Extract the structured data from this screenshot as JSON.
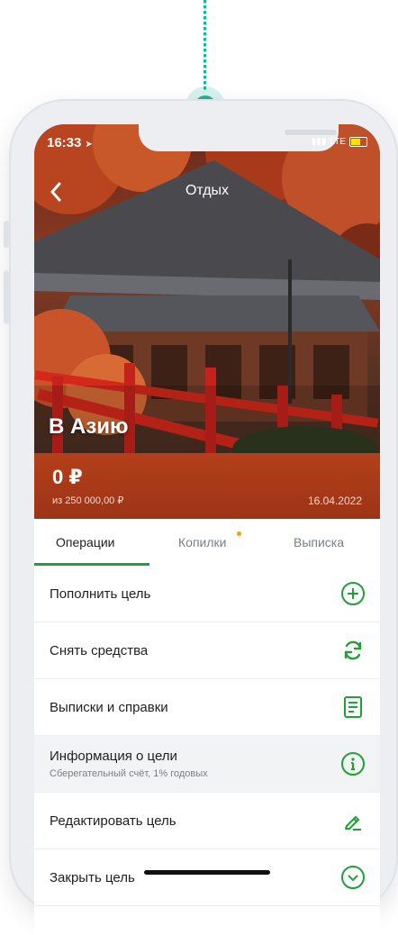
{
  "status_bar": {
    "time": "16:33",
    "network": "LTE"
  },
  "header": {
    "title": "Отдых",
    "goal_name": "В Азию"
  },
  "goal": {
    "amount": "0 ₽",
    "target": "из 250 000,00 ₽",
    "date": "16.04.2022"
  },
  "tabs": [
    {
      "label": "Операции",
      "active": true
    },
    {
      "label": "Копилки",
      "has_badge": true
    },
    {
      "label": "Выписка"
    }
  ],
  "actions": [
    {
      "label": "Пополнить цель",
      "icon": "plus-circle-icon"
    },
    {
      "label": "Снять средства",
      "icon": "refresh-icon"
    },
    {
      "label": "Выписки и справки",
      "icon": "document-icon"
    },
    {
      "label": "Информация о цели",
      "sub": "Сберегательный счёт,  1% годовых",
      "icon": "info-icon"
    },
    {
      "label": "Редактировать цель",
      "icon": "pencil-icon"
    },
    {
      "label": "Закрыть цель",
      "icon": "close-circle-icon"
    }
  ],
  "colors": {
    "accent": "#21a038",
    "connector": "#1fb29a",
    "amount_band": "#b4401b"
  }
}
